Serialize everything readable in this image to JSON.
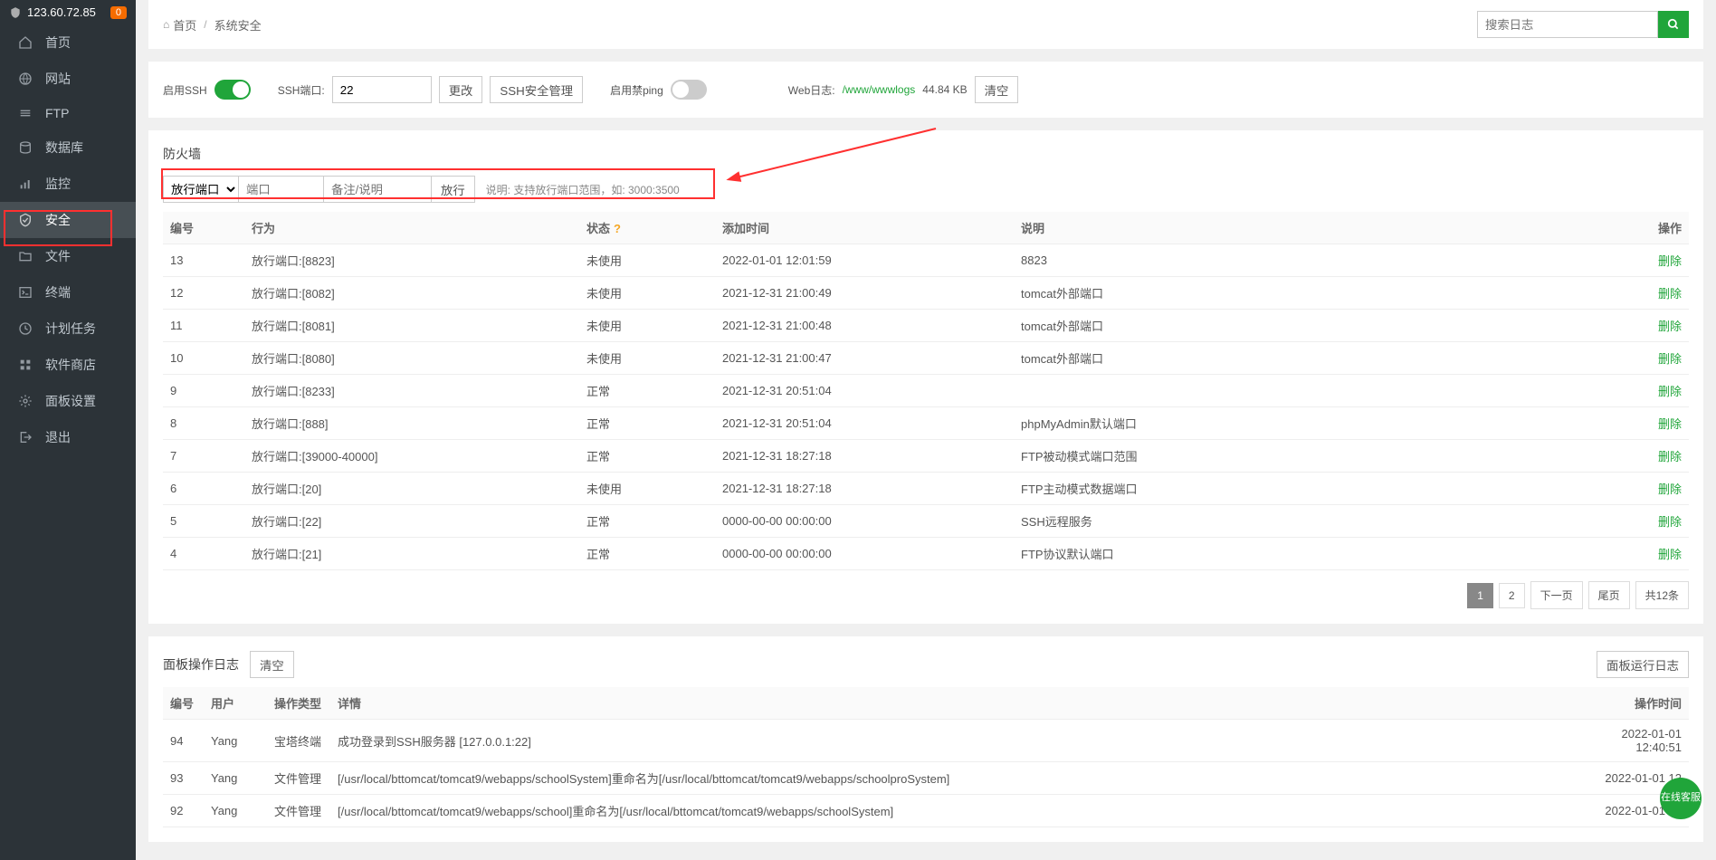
{
  "server_ip": "123.60.72.85",
  "badge": "0",
  "sidebar": [
    {
      "icon": "home",
      "label": "首页"
    },
    {
      "icon": "globe",
      "label": "网站"
    },
    {
      "icon": "ftp",
      "label": "FTP"
    },
    {
      "icon": "db",
      "label": "数据库"
    },
    {
      "icon": "monitor",
      "label": "监控"
    },
    {
      "icon": "security",
      "label": "安全",
      "active": true
    },
    {
      "icon": "file",
      "label": "文件"
    },
    {
      "icon": "terminal",
      "label": "终端"
    },
    {
      "icon": "cron",
      "label": "计划任务"
    },
    {
      "icon": "store",
      "label": "软件商店"
    },
    {
      "icon": "settings",
      "label": "面板设置"
    },
    {
      "icon": "logout",
      "label": "退出"
    }
  ],
  "breadcrumb": {
    "home": "首页",
    "current": "系统安全"
  },
  "search_placeholder": "搜索日志",
  "ssh": {
    "enable_label": "启用SSH",
    "port_label": "SSH端口:",
    "port_value": "22",
    "change_btn": "更改",
    "sec_btn": "SSH安全管理",
    "ping_label": "启用禁ping"
  },
  "weblog": {
    "label": "Web日志:",
    "path": "/www/wwwlogs",
    "size": "44.84 KB",
    "clear_btn": "清空"
  },
  "firewall": {
    "title": "防火墙",
    "select_label": "放行端口",
    "port_placeholder": "端口",
    "remark_placeholder": "备注/说明",
    "action_btn": "放行",
    "hint": "说明: 支持放行端口范围，如: 3000:3500",
    "columns": {
      "no": "编号",
      "behavior": "行为",
      "status": "状态",
      "add_time": "添加时间",
      "desc": "说明",
      "op": "操作"
    },
    "delete_label": "删除",
    "rows": [
      {
        "no": "13",
        "behavior": "放行端口:[8823]",
        "status": "未使用",
        "time": "2022-01-01 12:01:59",
        "desc": "8823"
      },
      {
        "no": "12",
        "behavior": "放行端口:[8082]",
        "status": "未使用",
        "time": "2021-12-31 21:00:49",
        "desc": "tomcat外部端口"
      },
      {
        "no": "11",
        "behavior": "放行端口:[8081]",
        "status": "未使用",
        "time": "2021-12-31 21:00:48",
        "desc": "tomcat外部端口"
      },
      {
        "no": "10",
        "behavior": "放行端口:[8080]",
        "status": "未使用",
        "time": "2021-12-31 21:00:47",
        "desc": "tomcat外部端口"
      },
      {
        "no": "9",
        "behavior": "放行端口:[8233]",
        "status": "正常",
        "time": "2021-12-31 20:51:04",
        "desc": ""
      },
      {
        "no": "8",
        "behavior": "放行端口:[888]",
        "status": "正常",
        "time": "2021-12-31 20:51:04",
        "desc": "phpMyAdmin默认端口"
      },
      {
        "no": "7",
        "behavior": "放行端口:[39000-40000]",
        "status": "正常",
        "time": "2021-12-31 18:27:18",
        "desc": "FTP被动模式端口范围"
      },
      {
        "no": "6",
        "behavior": "放行端口:[20]",
        "status": "未使用",
        "time": "2021-12-31 18:27:18",
        "desc": "FTP主动模式数据端口"
      },
      {
        "no": "5",
        "behavior": "放行端口:[22]",
        "status": "正常",
        "time": "0000-00-00 00:00:00",
        "desc": "SSH远程服务"
      },
      {
        "no": "4",
        "behavior": "放行端口:[21]",
        "status": "正常",
        "time": "0000-00-00 00:00:00",
        "desc": "FTP协议默认端口"
      }
    ],
    "pager": {
      "p1": "1",
      "p2": "2",
      "next": "下一页",
      "last": "尾页",
      "total": "共12条"
    }
  },
  "logs": {
    "title": "面板操作日志",
    "clear_btn": "清空",
    "run_log_btn": "面板运行日志",
    "columns": {
      "no": "编号",
      "user": "用户",
      "type": "操作类型",
      "detail": "详情",
      "time": "操作时间"
    },
    "rows": [
      {
        "no": "94",
        "user": "Yang",
        "type": "宝塔终端",
        "detail": "成功登录到SSH服务器 [127.0.0.1:22]",
        "time": "2022-01-01 12:40:51"
      },
      {
        "no": "93",
        "user": "Yang",
        "type": "文件管理",
        "detail": "[/usr/local/bttomcat/tomcat9/webapps/schoolSystem]重命名为[/usr/local/bttomcat/tomcat9/webapps/schoolproSystem]",
        "time": "2022-01-01 12"
      },
      {
        "no": "92",
        "user": "Yang",
        "type": "文件管理",
        "detail": "[/usr/local/bttomcat/tomcat9/webapps/school]重命名为[/usr/local/bttomcat/tomcat9/webapps/schoolSystem]",
        "time": "2022-01-01 12"
      }
    ]
  },
  "chat_label": "在线客服"
}
